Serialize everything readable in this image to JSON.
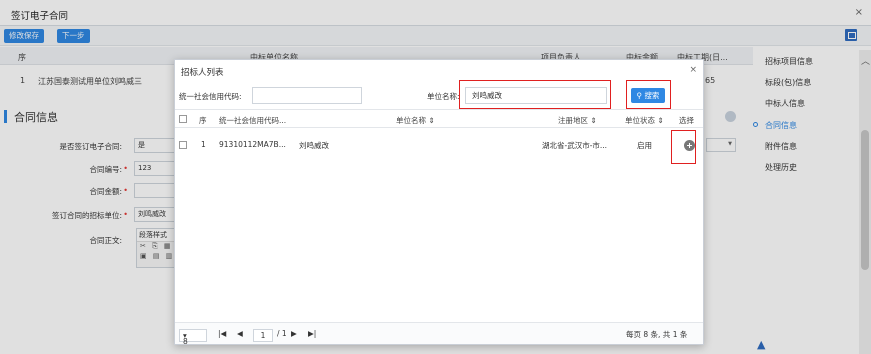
{
  "window": {
    "title": "签订电子合同",
    "close": "×"
  },
  "toolbar": {
    "save": "修改保存",
    "next": "下一步"
  },
  "bg_table": {
    "headers": {
      "seq": "序",
      "unit": "中标单位名称",
      "leader": "项目负责人",
      "amount": "中标金额",
      "period": "中标工期(日..."
    },
    "row": {
      "seq": "1",
      "unit": "江苏国泰测试用单位刘鸣威三",
      "period": "65"
    }
  },
  "section": {
    "title": "合同信息"
  },
  "form": {
    "is_electronic": {
      "label": "是否签订电子合同:",
      "value": "是"
    },
    "contract_no": {
      "label": "合同编号:",
      "value": "123"
    },
    "contract_amount": {
      "label": "合同金额:",
      "value": ""
    },
    "unit": {
      "label": "签订合同的招标单位:",
      "value": "刘鸣威改"
    },
    "body": {
      "label": "合同正文:",
      "style": "段落样式"
    }
  },
  "right_nav": {
    "items": [
      "招标项目信息",
      "标段(包)信息",
      "中标人信息",
      "合同信息",
      "附件信息",
      "处理历史"
    ],
    "active_index": 3
  },
  "dialog": {
    "title": "招标人列表",
    "close": "×",
    "search": {
      "credit_label": "统一社会信用代码:",
      "credit_value": "",
      "unit_label": "单位名称:",
      "unit_value": "刘鸣威改",
      "button": "搜索"
    },
    "grid": {
      "headers": {
        "seq": "序",
        "credit": "统一社会信用代码...",
        "unit": "单位名称 ⇕",
        "region": "注册地区 ⇕",
        "status": "单位状态 ⇕",
        "select": "选择"
      },
      "rows": [
        {
          "seq": "1",
          "credit": "91310112MA7B...",
          "unit": "刘鸣威改",
          "region": "湖北省-武汉市-市...",
          "status": "启用"
        }
      ]
    },
    "pager": {
      "size": "8",
      "page": "1",
      "total_pages": "/ 1",
      "summary": "每页 8 条, 共 1 条"
    }
  }
}
